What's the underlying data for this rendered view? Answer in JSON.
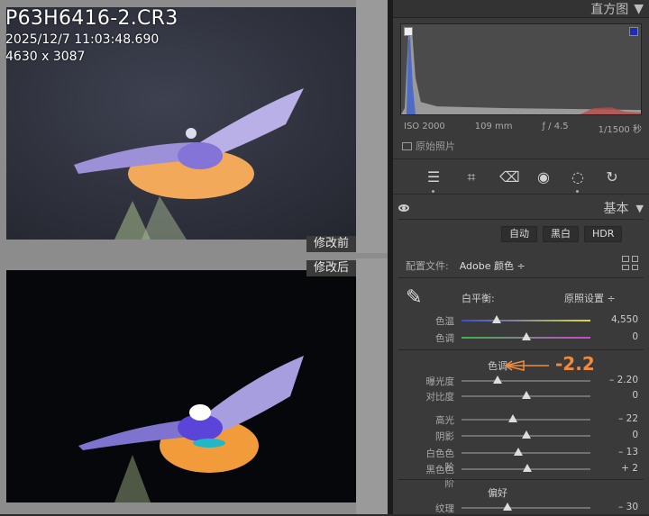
{
  "photo": {
    "filename": "P63H6416-2.CR3",
    "datetime": "2025/12/7 11:03:48.690",
    "dimensions": "4630 x 3087",
    "before_label": "修改前",
    "after_label": "修改后"
  },
  "histogram": {
    "title": "直方图",
    "iso": "ISO 2000",
    "focal": "109 mm",
    "aperture": "ƒ / 4.5",
    "shutter": "1/1500 秒",
    "original_label": "原始照片"
  },
  "basic": {
    "title": "基本",
    "auto_button": "自动",
    "bw_button": "黑白",
    "hdr_button": "HDR",
    "profile_label": "配置文件:",
    "profile_value": "Adobe 颜色 ÷",
    "wb_label": "白平衡:",
    "wb_value": "原照设置 ÷",
    "tone_title": "色调",
    "presence_title": "偏好",
    "annotation": "-2.2"
  },
  "sliders": [
    {
      "label": "色温",
      "value": "4,550",
      "pos": 0.27
    },
    {
      "label": "色调",
      "value": "0",
      "pos": 0.5
    },
    {
      "label": "曝光度",
      "value": "– 2.20",
      "pos": 0.28
    },
    {
      "label": "对比度",
      "value": "0",
      "pos": 0.5
    },
    {
      "label": "高光",
      "value": "– 22",
      "pos": 0.4
    },
    {
      "label": "阴影",
      "value": "0",
      "pos": 0.5
    },
    {
      "label": "白色色阶",
      "value": "– 13",
      "pos": 0.44
    },
    {
      "label": "黑色色阶",
      "value": "+ 2",
      "pos": 0.51
    },
    {
      "label": "纹理",
      "value": "– 30",
      "pos": 0.36
    }
  ],
  "colors": {
    "accent_orange": "#f08a3c",
    "panel_bg": "#3a3a3a",
    "viewer_bg": "#8c8c8c"
  }
}
